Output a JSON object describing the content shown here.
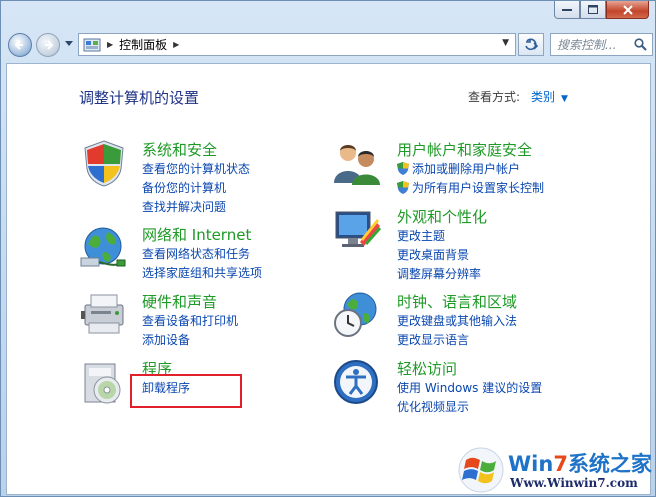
{
  "address": {
    "path_label": "控制面板"
  },
  "search": {
    "placeholder": "搜索控制..."
  },
  "page": {
    "title": "调整计算机的设置",
    "view_by_label": "查看方式:",
    "view_by_value": "类别"
  },
  "categories": [
    {
      "title": "系统和安全",
      "icon": "system-security-icon",
      "links": [
        "查看您的计算机状态",
        "备份您的计算机",
        "查找并解决问题"
      ]
    },
    {
      "title": "网络和 Internet",
      "icon": "network-icon",
      "links": [
        "查看网络状态和任务",
        "选择家庭组和共享选项"
      ]
    },
    {
      "title": "硬件和声音",
      "icon": "hardware-sound-icon",
      "links": [
        "查看设备和打印机",
        "添加设备"
      ]
    },
    {
      "title": "程序",
      "icon": "programs-icon",
      "links": [
        "卸载程序"
      ]
    },
    {
      "title": "用户帐户和家庭安全",
      "icon": "user-accounts-icon",
      "links": [
        "添加或删除用户帐户",
        "为所有用户设置家长控制"
      ]
    },
    {
      "title": "外观和个性化",
      "icon": "appearance-icon",
      "links": [
        "更改主题",
        "更改桌面背景",
        "调整屏幕分辨率"
      ]
    },
    {
      "title": "时钟、语言和区域",
      "icon": "clock-region-icon",
      "links": [
        "更改键盘或其他输入法",
        "更改显示语言"
      ]
    },
    {
      "title": "轻松访问",
      "icon": "ease-of-access-icon",
      "links": [
        "使用 Windows 建议的设置",
        "优化视频显示"
      ]
    }
  ],
  "watermark": {
    "brand_win": "Win",
    "brand_seven": "7",
    "brand_rest": "系统之家",
    "url": "Www.Winwin7.com"
  },
  "colors": {
    "category_title": "#1e9a26",
    "link": "#0a47b0",
    "highlight_box": "#e0202b"
  }
}
